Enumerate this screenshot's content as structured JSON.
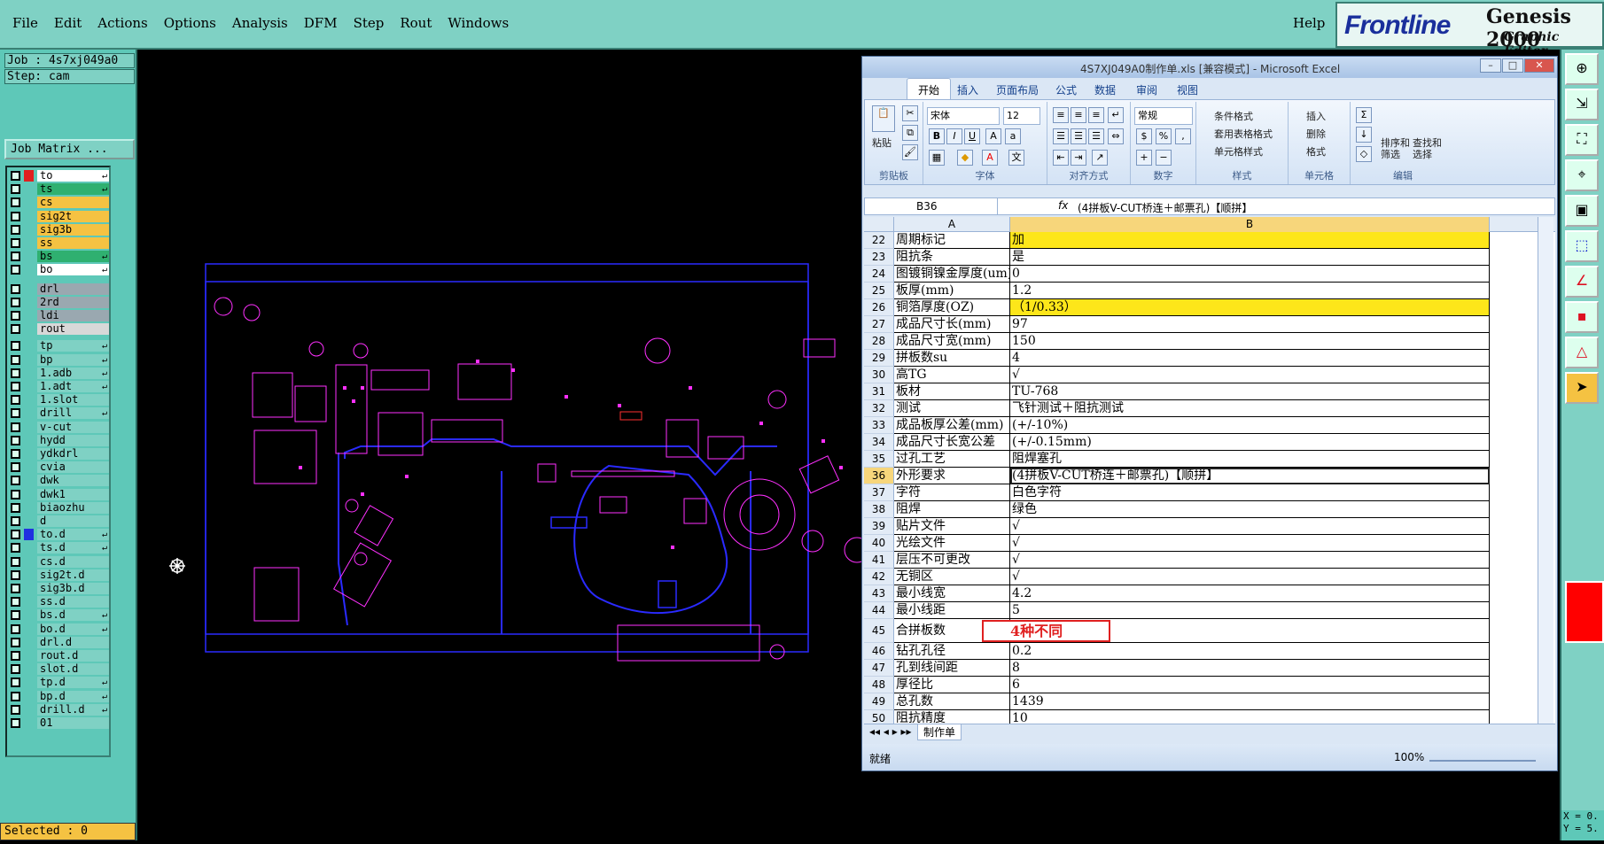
{
  "menu": [
    "File",
    "Edit",
    "Actions",
    "Options",
    "Analysis",
    "DFM",
    "Step",
    "Rout",
    "Windows"
  ],
  "help": "Help",
  "logo": {
    "brand": "Frontline",
    "product": "Genesis 2000",
    "subtitle": "Graphic Editor"
  },
  "job": {
    "line": "Job : 4s7xj049a0",
    "step": "Step: cam",
    "matrix_button": "Job Matrix ..."
  },
  "layers": [
    {
      "name": "to",
      "color": "#ffffff",
      "marker": "#e02020",
      "arrow": "↵"
    },
    {
      "name": "ts",
      "color": "#2fb070",
      "arrow": "↵"
    },
    {
      "name": "cs",
      "color": "#f5c242"
    },
    {
      "name": "sig2t",
      "color": "#f5c242"
    },
    {
      "name": "sig3b",
      "color": "#f5c242"
    },
    {
      "name": "ss",
      "color": "#f5c242"
    },
    {
      "name": "bs",
      "color": "#2fb070",
      "arrow": "↵"
    },
    {
      "name": "bo",
      "color": "#ffffff",
      "arrow": "↵"
    },
    {
      "name": "drl",
      "color": "#9aa8b0"
    },
    {
      "name": "2rd",
      "color": "#9aa8b0"
    },
    {
      "name": "ldi",
      "color": "#9aa8b0"
    },
    {
      "name": "rout",
      "color": "#d8d8d8"
    },
    {
      "name": "tp",
      "arrow": "↵"
    },
    {
      "name": "bp",
      "arrow": "↵"
    },
    {
      "name": "1.adb",
      "arrow": "↵"
    },
    {
      "name": "1.adt",
      "arrow": "↵"
    },
    {
      "name": "1.slot"
    },
    {
      "name": "drill",
      "arrow": "↵"
    },
    {
      "name": "v-cut"
    },
    {
      "name": "hydd"
    },
    {
      "name": "ydkdrl"
    },
    {
      "name": "cvia"
    },
    {
      "name": "dwk"
    },
    {
      "name": "dwk1"
    },
    {
      "name": "biaozhu"
    },
    {
      "name": "d"
    },
    {
      "name": "to.d",
      "marker": "#2030e0",
      "arrow": "↵"
    },
    {
      "name": "ts.d",
      "arrow": "↵"
    },
    {
      "name": "cs.d"
    },
    {
      "name": "sig2t.d"
    },
    {
      "name": "sig3b.d"
    },
    {
      "name": "ss.d"
    },
    {
      "name": "bs.d",
      "arrow": "↵"
    },
    {
      "name": "bo.d",
      "arrow": "↵"
    },
    {
      "name": "drl.d"
    },
    {
      "name": "rout.d"
    },
    {
      "name": "slot.d"
    },
    {
      "name": "tp.d",
      "arrow": "↵"
    },
    {
      "name": "bp.d",
      "arrow": "↵"
    },
    {
      "name": "drill.d",
      "arrow": "↵"
    },
    {
      "name": "01"
    }
  ],
  "selected": "Selected : 0",
  "excel": {
    "title": "4S7XJ049A0制作单.xls [兼容模式] - Microsoft Excel",
    "tabs": [
      "开始",
      "插入",
      "页面布局",
      "公式",
      "数据",
      "审阅",
      "视图"
    ],
    "ribbon": {
      "paste": "粘贴",
      "font_name": "宋体",
      "font_size": "12",
      "number_format": "常规",
      "cond_format": "条件格式",
      "table_format": "套用表格格式",
      "cell_style": "单元格样式",
      "insert": "插入",
      "delete": "删除",
      "format": "格式",
      "sort_filter": "排序和\n筛选",
      "find_select": "查找和\n选择",
      "groups": [
        "剪贴板",
        "字体",
        "对齐方式",
        "数字",
        "样式",
        "单元格",
        "编辑"
      ]
    },
    "name_box": "B36",
    "formula": "(4拼板V-CUT桥连＋邮票孔)【顺拼】",
    "columns": [
      "A",
      "B"
    ],
    "rows": [
      {
        "n": "22",
        "a": "周期标记",
        "b": "加",
        "yellow": true
      },
      {
        "n": "23",
        "a": "阻抗条",
        "b": "是"
      },
      {
        "n": "24",
        "a": "图镀铜镍金厚度(um)",
        "b": "0"
      },
      {
        "n": "25",
        "a": "板厚(mm)",
        "b": "1.2"
      },
      {
        "n": "26",
        "a": "铜箔厚度(OZ)",
        "b": "（1/0.33）",
        "yellow": true
      },
      {
        "n": "27",
        "a": "成品尺寸长(mm)",
        "b": "97"
      },
      {
        "n": "28",
        "a": "成品尺寸宽(mm)",
        "b": "150"
      },
      {
        "n": "29",
        "a": "拼板数su",
        "b": "4"
      },
      {
        "n": "30",
        "a": "高TG",
        "b": "√"
      },
      {
        "n": "31",
        "a": "板材",
        "b": "TU-768"
      },
      {
        "n": "32",
        "a": "测试",
        "b": "飞针测试＋阻抗测试"
      },
      {
        "n": "33",
        "a": "成品板厚公差(mm)",
        "b": "(+/-10%)"
      },
      {
        "n": "34",
        "a": "成品尺寸长宽公差",
        "b": "(+/-0.15mm)"
      },
      {
        "n": "35",
        "a": "过孔工艺",
        "b": "阻焊塞孔"
      },
      {
        "n": "36",
        "a": "外形要求",
        "b": "(4拼板V-CUT桥连＋邮票孔)【顺拼】",
        "selected": true
      },
      {
        "n": "37",
        "a": "字符",
        "b": "白色字符"
      },
      {
        "n": "38",
        "a": "阻焊",
        "b": "绿色"
      },
      {
        "n": "39",
        "a": "贴片文件",
        "b": "√"
      },
      {
        "n": "40",
        "a": "光绘文件",
        "b": "√"
      },
      {
        "n": "41",
        "a": "层压不可更改",
        "b": "√"
      },
      {
        "n": "42",
        "a": "无铜区",
        "b": "√"
      },
      {
        "n": "43",
        "a": "最小线宽",
        "b": "4.2"
      },
      {
        "n": "44",
        "a": "最小线距",
        "b": "5"
      },
      {
        "n": "45",
        "a": "合拼板数",
        "b": "",
        "tall": true
      },
      {
        "n": "46",
        "a": "钻孔孔径",
        "b": "0.2"
      },
      {
        "n": "47",
        "a": "孔到线间距",
        "b": "8"
      },
      {
        "n": "48",
        "a": "厚径比",
        "b": "6"
      },
      {
        "n": "49",
        "a": "总孔数",
        "b": "1439"
      },
      {
        "n": "50",
        "a": "阻抗精度",
        "b": "10"
      }
    ],
    "callout": "4种不同",
    "sheet_tab": "制作单",
    "status_ready": "就绪",
    "zoom": "100%"
  },
  "coords": {
    "x": "X = 0.",
    "y": "Y = 5."
  }
}
